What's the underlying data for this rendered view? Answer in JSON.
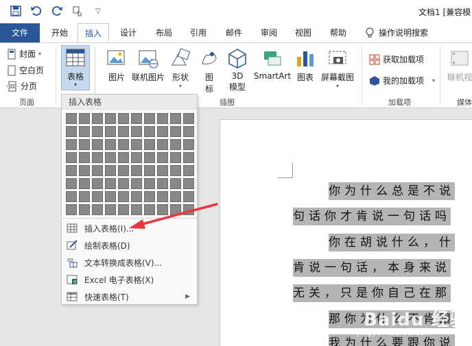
{
  "window": {
    "title": "文档1 [兼容模"
  },
  "qat": {
    "save_icon": "save-icon",
    "undo_icon": "undo-icon",
    "redo_icon": "redo-icon",
    "touch_icon": "touch-mode-icon",
    "customize_icon": "customize-qat-icon"
  },
  "tabs": [
    {
      "label": "文件"
    },
    {
      "label": "开始"
    },
    {
      "label": "插入"
    },
    {
      "label": "设计"
    },
    {
      "label": "布局"
    },
    {
      "label": "引用"
    },
    {
      "label": "邮件"
    },
    {
      "label": "审阅"
    },
    {
      "label": "视图"
    },
    {
      "label": "帮助"
    }
  ],
  "tellme": {
    "label": "操作说明搜索"
  },
  "ribbon": {
    "pages_group": {
      "label": "页面",
      "cover": "封面",
      "blank": "空白页",
      "break": "分页"
    },
    "table_button": {
      "label": "表格"
    },
    "illustrations_group": {
      "label": "插图",
      "picture": "图片",
      "online_picture": "联机图片",
      "shapes": "形状",
      "icons": "图\n标",
      "icons_line1": "图",
      "icons_line2": "标",
      "model3d_line1": "3D",
      "model3d_line2": "模型",
      "smartart": "SmartArt",
      "chart": "图表",
      "screenshot": "屏幕截图"
    },
    "addins_group": {
      "label": "加载项",
      "get_addins": "获取加载项",
      "my_addins": "我的加载项"
    },
    "media_group": {
      "label": "媒体",
      "online_video": "联机视"
    }
  },
  "dropdown": {
    "header": "插入表格",
    "grid_cols": 10,
    "grid_rows": 8,
    "items": [
      {
        "label": "插入表格(I)..."
      },
      {
        "label": "绘制表格(D)"
      },
      {
        "label": "文本转换成表格(V)..."
      },
      {
        "label": "Excel 电子表格(X)"
      },
      {
        "label": "快速表格(T)"
      }
    ]
  },
  "document": {
    "lines": [
      "你为什么总是不说",
      "句话你才肯说一句话吗",
      "你在胡说什么，什",
      "肯说一句话，本身来说",
      "无关，只是你自己在那",
      "那你为什么不肯跟",
      "我为什么要跟你说"
    ]
  },
  "watermark": {
    "brand": "Baidu 经验",
    "site": "jingyan.baidu.com"
  }
}
